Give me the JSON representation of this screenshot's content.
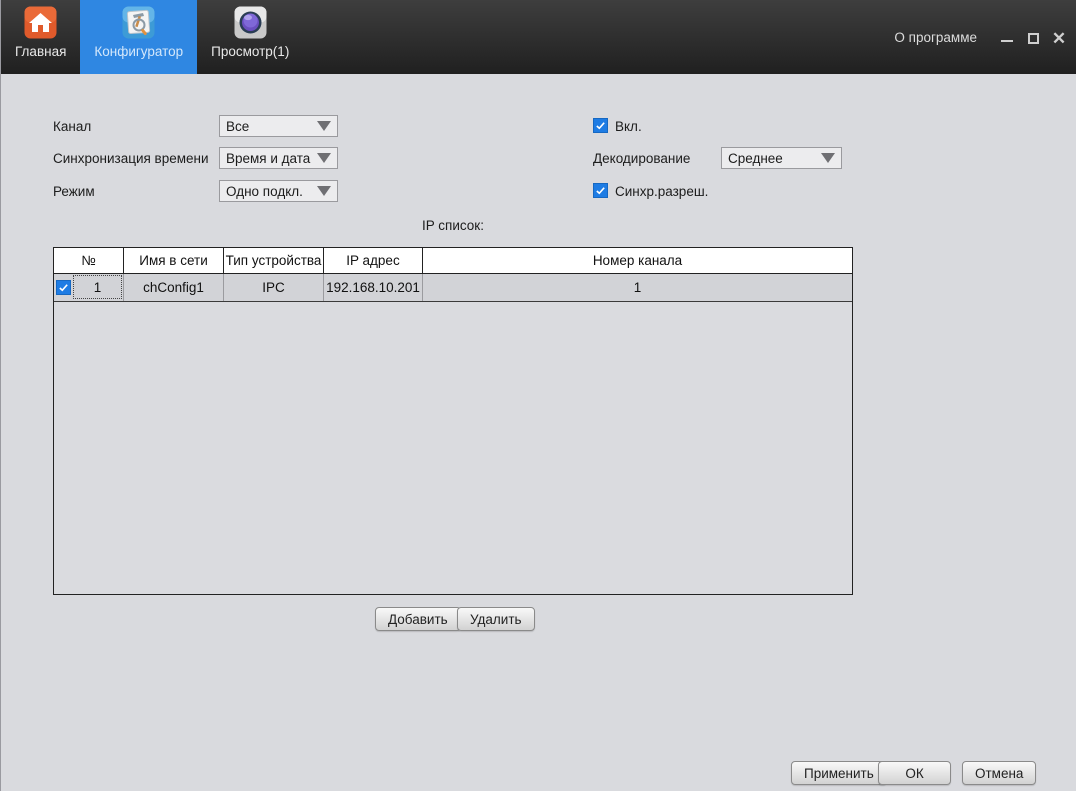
{
  "window": {
    "about_label": "О программе"
  },
  "tabs": [
    {
      "label": "Главная",
      "active": false
    },
    {
      "label": "Конфигуратор",
      "active": true
    },
    {
      "label": "Просмотр(1)",
      "active": false
    }
  ],
  "form": {
    "channel": {
      "label": "Канал",
      "value": "Все"
    },
    "time_sync": {
      "label": "Синхронизация времени",
      "value": "Время и дата"
    },
    "mode": {
      "label": "Режим",
      "value": "Одно подкл."
    },
    "enable": {
      "label": "Вкл.",
      "checked": true
    },
    "decoding": {
      "label": "Декодирование",
      "value": "Среднее"
    },
    "sync_resolution": {
      "label": "Синхр.разреш.",
      "checked": true
    }
  },
  "ip_list": {
    "title": "IP список:",
    "columns": [
      "№",
      "Имя в сети",
      "Тип устройства",
      "IP адрес",
      "Номер канала"
    ],
    "rows": [
      {
        "checked": true,
        "num": "1",
        "name": "chConfig1",
        "type": "IPC",
        "ip": "192.168.10.201",
        "channel": "1"
      }
    ],
    "add_button": "Добавить",
    "delete_button": "Удалить"
  },
  "footer": {
    "apply_button": "Применить",
    "ok_button": "ОК",
    "cancel_button": "Отмена"
  },
  "colors": {
    "accent_blue": "#2f87e2",
    "checkbox_blue": "#1e7ce4",
    "topbar_dark": "#202020",
    "page_bg": "#d9dade"
  }
}
